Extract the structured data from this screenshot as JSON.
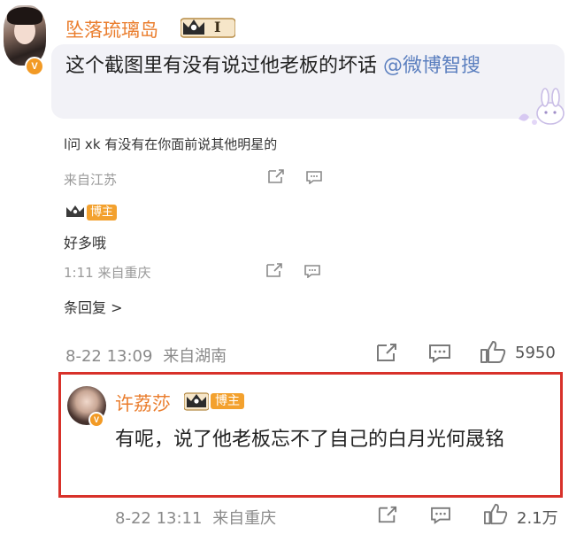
{
  "post": {
    "username": "坠落琉璃岛",
    "level_badge": "I",
    "content": "这个截图里有没有说过他老板的坏话",
    "mention": "@微博智搜"
  },
  "screenshot_thread": {
    "reply1_text": "l问 xk 有没有在你面前说其他明星的",
    "reply1_meta": "来自江苏",
    "reply2_badge": "博主",
    "reply2_text": "好多哦",
    "reply2_meta": "1:11  来自重庆",
    "more_replies": "条回复 >"
  },
  "post_meta": {
    "time": "8-22 13:09",
    "location": "来自湖南",
    "likes": "5950"
  },
  "reply": {
    "username": "许荔莎",
    "badge": "博主",
    "content": "有呢，说了他老板忘不了自己的白月光何晟铭",
    "time": "8-22 13:11",
    "location": "来自重庆",
    "likes": "2.1万"
  },
  "colors": {
    "username": "#ea7d2d",
    "mention": "#5b7fbf",
    "highlight_border": "#d8312a",
    "bozhu_badge": "#f3a12e"
  },
  "icons": [
    "share-icon",
    "comment-icon",
    "like-icon",
    "crown-badge-icon",
    "verified-v-icon",
    "bunny-sticker-icon"
  ]
}
